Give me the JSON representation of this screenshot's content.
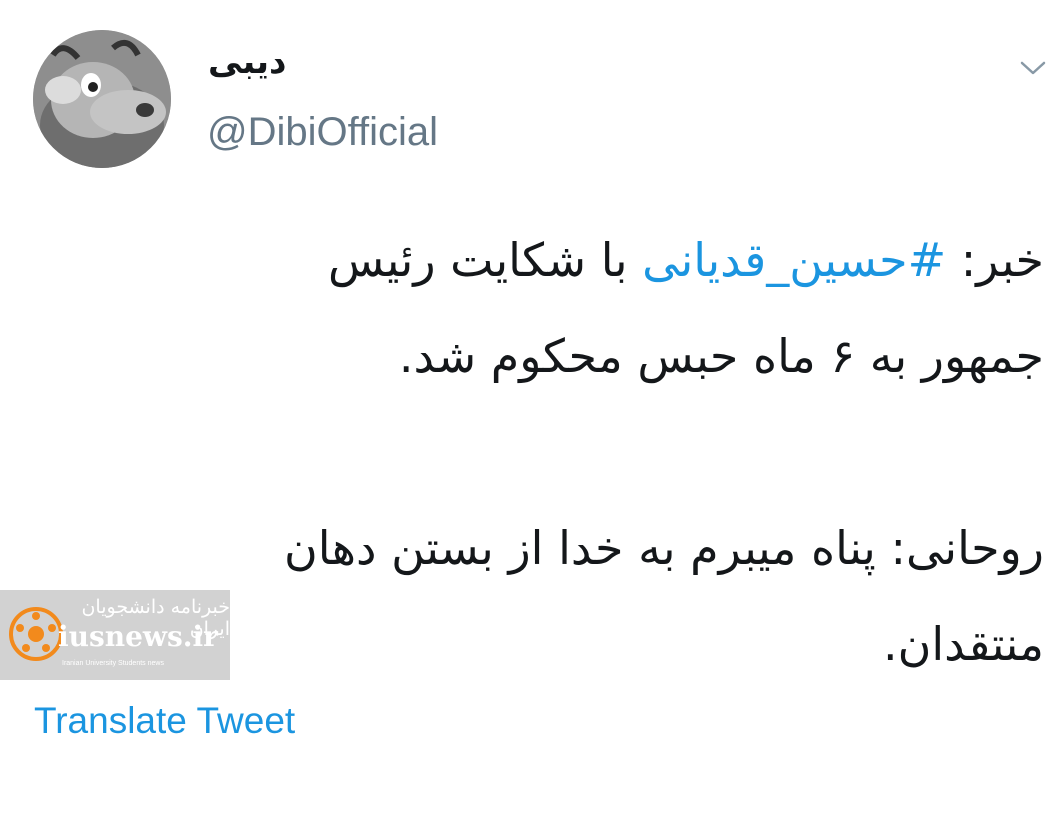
{
  "author": {
    "display_name": "دیبی",
    "handle": "@DibiOfficial",
    "avatar_icon": "avatar-image"
  },
  "menu": {
    "icon": "chevron-down-icon"
  },
  "tweet": {
    "line1_a": "خبر: ",
    "hashtag": "#حسین_قدیانی",
    "line1_b": " با شکایت رئیس",
    "line2": "جمهور به ۶ ماه حبس محکوم شد.",
    "line3": "روحانی: پناه میبرم به خدا از بستن دهان",
    "line4": "منتقدان."
  },
  "watermark": {
    "text_fa": "خبرنامه دانشجویان ایران",
    "url": "iusnews.ir",
    "subtitle": "Iranian University Students news"
  },
  "actions": {
    "translate_label": "Translate Tweet"
  },
  "colors": {
    "link": "#1b95e0",
    "secondary": "#657786",
    "text": "#14171a"
  }
}
